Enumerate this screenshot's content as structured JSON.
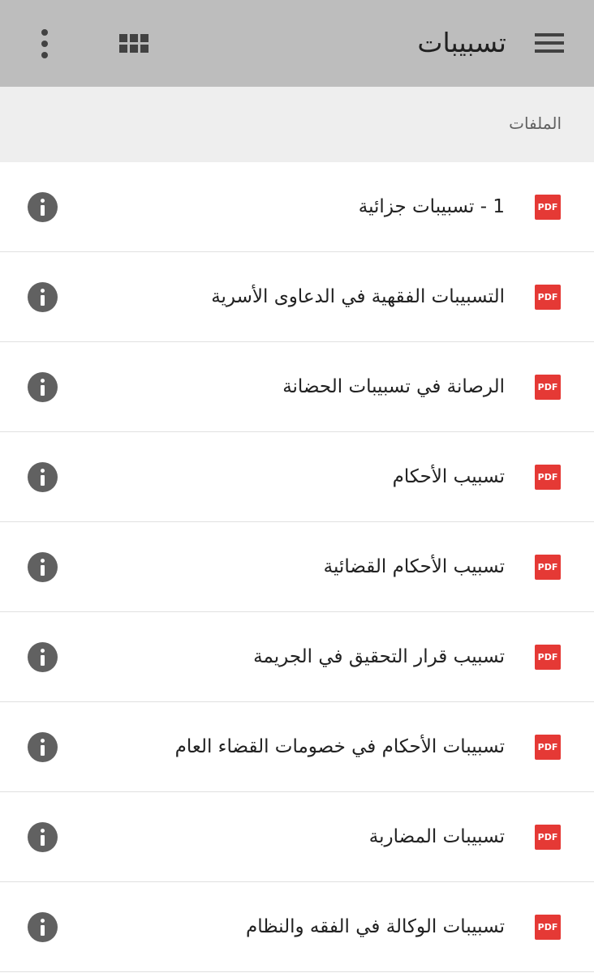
{
  "app_bar": {
    "title": "تسبيبات",
    "menu_icon": "hamburger-menu-icon",
    "view_icon": "grid-view-icon",
    "more_icon": "more-vertical-icon",
    "background_color": "#bdbdbd"
  },
  "section": {
    "title": "الملفات"
  },
  "files": [
    {
      "name": "1 - تسبيبات جزائية",
      "type_label": "PDF"
    },
    {
      "name": "التسبيبات الفقهية في الدعاوى الأسرية",
      "type_label": "PDF"
    },
    {
      "name": "الرصانة في تسبيبات الحضانة",
      "type_label": "PDF"
    },
    {
      "name": "تسبيب الأحكام",
      "type_label": "PDF"
    },
    {
      "name": "تسبيب الأحكام القضائية",
      "type_label": "PDF"
    },
    {
      "name": "تسبيب قرار التحقيق في الجريمة",
      "type_label": "PDF"
    },
    {
      "name": "تسبيبات الأحكام في خصومات القضاء العام",
      "type_label": "PDF"
    },
    {
      "name": "تسبيبات المضاربة",
      "type_label": "PDF"
    },
    {
      "name": "تسبيبات الوكالة في الفقه والنظام",
      "type_label": "PDF"
    }
  ],
  "colors": {
    "pdf_badge": "#e53935",
    "info_icon": "#616161",
    "section_header_bg": "#eeeeee"
  }
}
